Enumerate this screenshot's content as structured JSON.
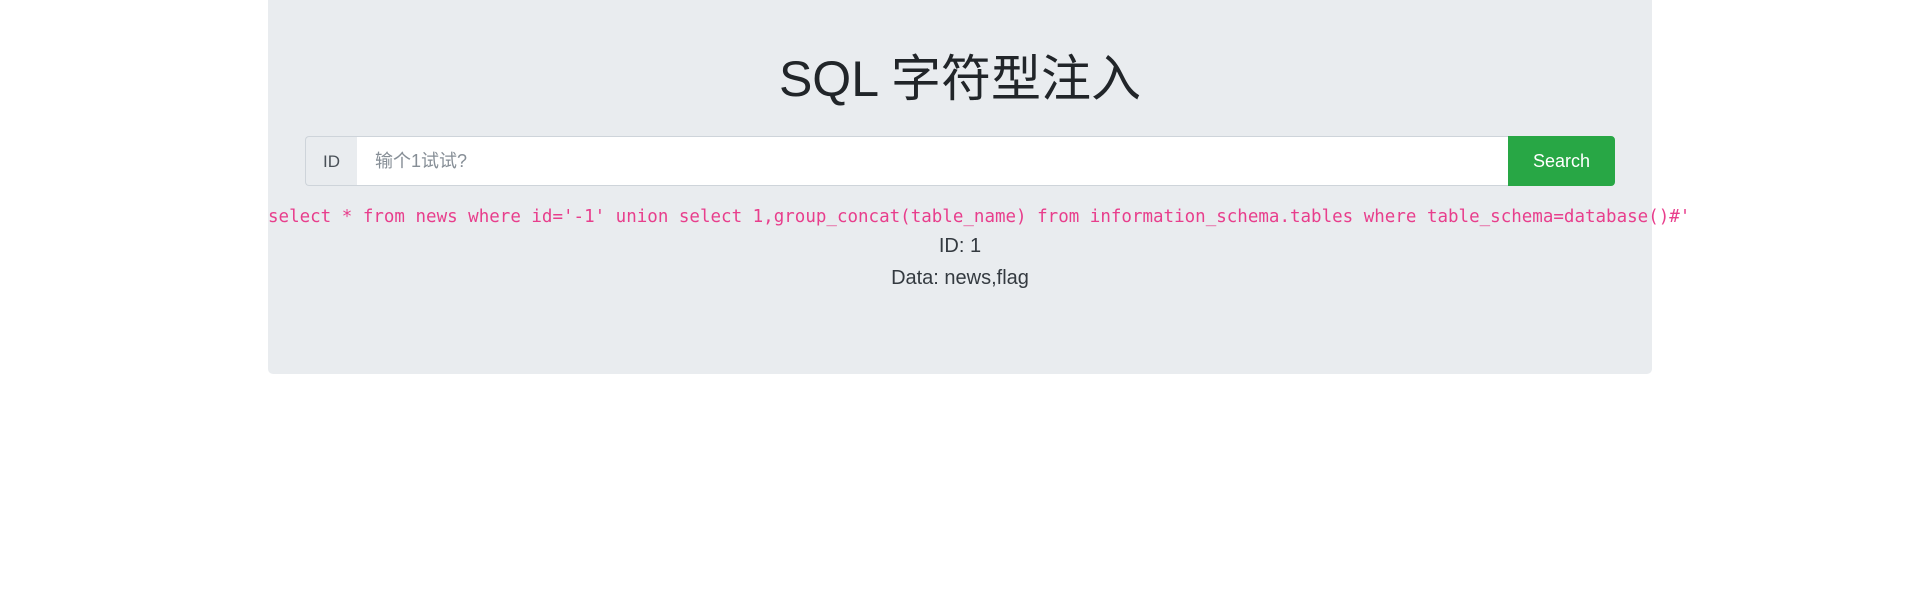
{
  "container": {
    "background_color": "#e9ecef"
  },
  "header": {
    "title": "SQL 字符型注入"
  },
  "search_form": {
    "prefix_label": "ID",
    "input_value": "",
    "input_placeholder": "输个1试试?",
    "submit_label": "Search",
    "submit_color": "#28a745"
  },
  "results": {
    "sql_query": "select * from news where id='-1' union select 1,group_concat(table_name) from information_schema.tables where table_schema=database()#'",
    "sql_color": "#e83e8c",
    "id_line": "ID: 1",
    "data_line": "Data: news,flag"
  }
}
